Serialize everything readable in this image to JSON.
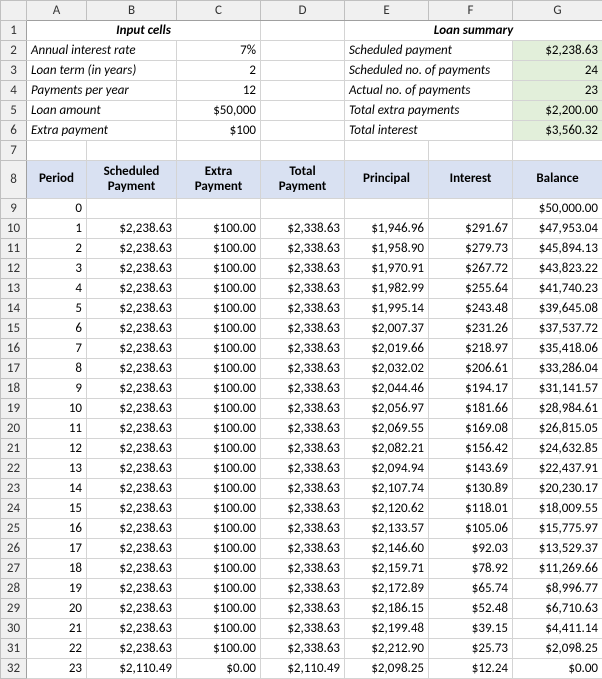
{
  "columns": [
    "A",
    "B",
    "C",
    "D",
    "E",
    "F",
    "G"
  ],
  "row_numbers": [
    "1",
    "2",
    "3",
    "4",
    "5",
    "6",
    "7",
    "8",
    "9",
    "10",
    "11",
    "12",
    "13",
    "14",
    "15",
    "16",
    "17",
    "18",
    "19",
    "20",
    "21",
    "22",
    "23",
    "24",
    "25",
    "26",
    "27",
    "28",
    "29",
    "30",
    "31",
    "32"
  ],
  "headers": {
    "input_cells": "Input cells",
    "loan_summary": "Loan summary"
  },
  "inputs": {
    "annual_rate_label": "Annual interest rate",
    "annual_rate_value": "7%",
    "loan_term_label": "Loan term (in years)",
    "loan_term_value": "2",
    "payments_per_year_label": "Payments per year",
    "payments_per_year_value": "12",
    "loan_amount_label": "Loan amount",
    "loan_amount_value": "$50,000",
    "extra_payment_label": "Extra payment",
    "extra_payment_value": "$100"
  },
  "summary": {
    "scheduled_payment_label": "Scheduled payment",
    "scheduled_payment_value": "$2,238.63",
    "scheduled_no_label": "Scheduled no. of payments",
    "scheduled_no_value": "24",
    "actual_no_label": "Actual no. of payments",
    "actual_no_value": "23",
    "total_extra_label": "Total extra payments",
    "total_extra_value": "$2,200.00",
    "total_interest_label": "Total interest",
    "total_interest_value": "$3,560.32"
  },
  "table_headers": {
    "period": "Period",
    "scheduled_payment": "Scheduled Payment",
    "extra_payment": "Extra Payment",
    "total_payment": "Total Payment",
    "principal": "Principal",
    "interest": "Interest",
    "balance": "Balance"
  },
  "chart_data": {
    "type": "table",
    "columns": [
      "Period",
      "Scheduled Payment",
      "Extra Payment",
      "Total Payment",
      "Principal",
      "Interest",
      "Balance"
    ],
    "rows": [
      {
        "period": "0",
        "scheduled": "",
        "extra": "",
        "total": "",
        "principal": "",
        "interest": "",
        "balance": "$50,000.00"
      },
      {
        "period": "1",
        "scheduled": "$2,238.63",
        "extra": "$100.00",
        "total": "$2,338.63",
        "principal": "$1,946.96",
        "interest": "$291.67",
        "balance": "$47,953.04"
      },
      {
        "period": "2",
        "scheduled": "$2,238.63",
        "extra": "$100.00",
        "total": "$2,338.63",
        "principal": "$1,958.90",
        "interest": "$279.73",
        "balance": "$45,894.13"
      },
      {
        "period": "3",
        "scheduled": "$2,238.63",
        "extra": "$100.00",
        "total": "$2,338.63",
        "principal": "$1,970.91",
        "interest": "$267.72",
        "balance": "$43,823.22"
      },
      {
        "period": "4",
        "scheduled": "$2,238.63",
        "extra": "$100.00",
        "total": "$2,338.63",
        "principal": "$1,982.99",
        "interest": "$255.64",
        "balance": "$41,740.23"
      },
      {
        "period": "5",
        "scheduled": "$2,238.63",
        "extra": "$100.00",
        "total": "$2,338.63",
        "principal": "$1,995.14",
        "interest": "$243.48",
        "balance": "$39,645.08"
      },
      {
        "period": "6",
        "scheduled": "$2,238.63",
        "extra": "$100.00",
        "total": "$2,338.63",
        "principal": "$2,007.37",
        "interest": "$231.26",
        "balance": "$37,537.72"
      },
      {
        "period": "7",
        "scheduled": "$2,238.63",
        "extra": "$100.00",
        "total": "$2,338.63",
        "principal": "$2,019.66",
        "interest": "$218.97",
        "balance": "$35,418.06"
      },
      {
        "period": "8",
        "scheduled": "$2,238.63",
        "extra": "$100.00",
        "total": "$2,338.63",
        "principal": "$2,032.02",
        "interest": "$206.61",
        "balance": "$33,286.04"
      },
      {
        "period": "9",
        "scheduled": "$2,238.63",
        "extra": "$100.00",
        "total": "$2,338.63",
        "principal": "$2,044.46",
        "interest": "$194.17",
        "balance": "$31,141.57"
      },
      {
        "period": "10",
        "scheduled": "$2,238.63",
        "extra": "$100.00",
        "total": "$2,338.63",
        "principal": "$2,056.97",
        "interest": "$181.66",
        "balance": "$28,984.61"
      },
      {
        "period": "11",
        "scheduled": "$2,238.63",
        "extra": "$100.00",
        "total": "$2,338.63",
        "principal": "$2,069.55",
        "interest": "$169.08",
        "balance": "$26,815.05"
      },
      {
        "period": "12",
        "scheduled": "$2,238.63",
        "extra": "$100.00",
        "total": "$2,338.63",
        "principal": "$2,082.21",
        "interest": "$156.42",
        "balance": "$24,632.85"
      },
      {
        "period": "13",
        "scheduled": "$2,238.63",
        "extra": "$100.00",
        "total": "$2,338.63",
        "principal": "$2,094.94",
        "interest": "$143.69",
        "balance": "$22,437.91"
      },
      {
        "period": "14",
        "scheduled": "$2,238.63",
        "extra": "$100.00",
        "total": "$2,338.63",
        "principal": "$2,107.74",
        "interest": "$130.89",
        "balance": "$20,230.17"
      },
      {
        "period": "15",
        "scheduled": "$2,238.63",
        "extra": "$100.00",
        "total": "$2,338.63",
        "principal": "$2,120.62",
        "interest": "$118.01",
        "balance": "$18,009.55"
      },
      {
        "period": "16",
        "scheduled": "$2,238.63",
        "extra": "$100.00",
        "total": "$2,338.63",
        "principal": "$2,133.57",
        "interest": "$105.06",
        "balance": "$15,775.97"
      },
      {
        "period": "17",
        "scheduled": "$2,238.63",
        "extra": "$100.00",
        "total": "$2,338.63",
        "principal": "$2,146.60",
        "interest": "$92.03",
        "balance": "$13,529.37"
      },
      {
        "period": "18",
        "scheduled": "$2,238.63",
        "extra": "$100.00",
        "total": "$2,338.63",
        "principal": "$2,159.71",
        "interest": "$78.92",
        "balance": "$11,269.66"
      },
      {
        "period": "19",
        "scheduled": "$2,238.63",
        "extra": "$100.00",
        "total": "$2,338.63",
        "principal": "$2,172.89",
        "interest": "$65.74",
        "balance": "$8,996.77"
      },
      {
        "period": "20",
        "scheduled": "$2,238.63",
        "extra": "$100.00",
        "total": "$2,338.63",
        "principal": "$2,186.15",
        "interest": "$52.48",
        "balance": "$6,710.63"
      },
      {
        "period": "21",
        "scheduled": "$2,238.63",
        "extra": "$100.00",
        "total": "$2,338.63",
        "principal": "$2,199.48",
        "interest": "$39.15",
        "balance": "$4,411.14"
      },
      {
        "period": "22",
        "scheduled": "$2,238.63",
        "extra": "$100.00",
        "total": "$2,338.63",
        "principal": "$2,212.90",
        "interest": "$25.73",
        "balance": "$2,098.25"
      },
      {
        "period": "23",
        "scheduled": "$2,110.49",
        "extra": "$0.00",
        "total": "$2,110.49",
        "principal": "$2,098.25",
        "interest": "$12.24",
        "balance": "$0.00"
      }
    ]
  }
}
